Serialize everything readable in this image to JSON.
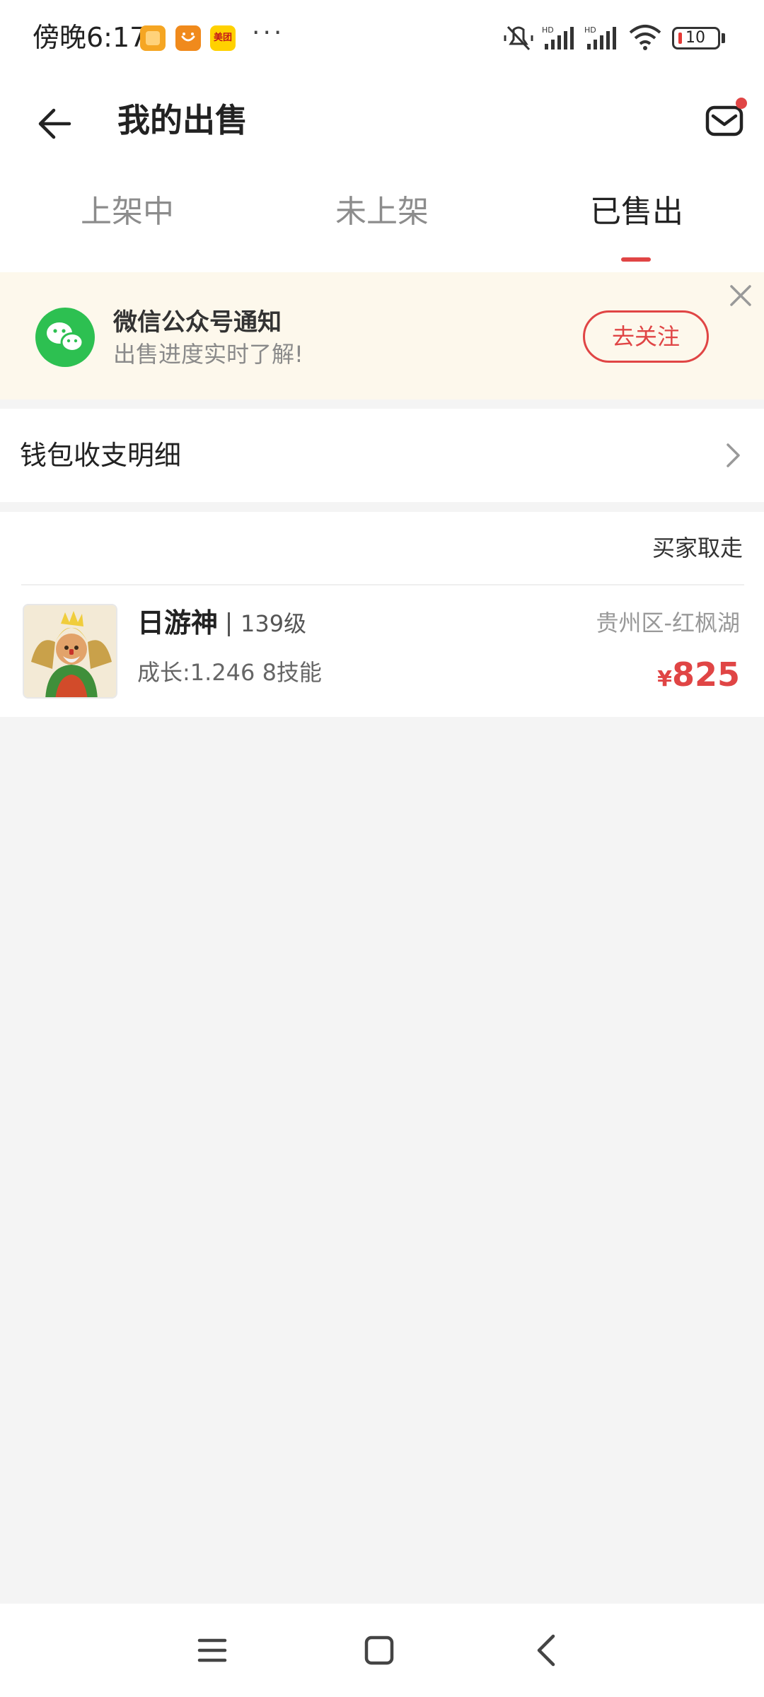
{
  "status_bar": {
    "time": "傍晚6:17",
    "app_icons": [
      "gallery-icon",
      "taobao-icon",
      "meituan-icon"
    ],
    "meituan_text": "美团",
    "more": "···",
    "battery": "10"
  },
  "header": {
    "title": "我的出售",
    "back_icon": "back-arrow-icon",
    "message_icon": "mail-icon",
    "has_unread_dot": true
  },
  "tabs": [
    {
      "label": "上架中",
      "active": false
    },
    {
      "label": "未上架",
      "active": false
    },
    {
      "label": "已售出",
      "active": true
    }
  ],
  "notice": {
    "title": "微信公众号通知",
    "subtitle": "出售进度实时了解!",
    "button": "去关注",
    "icon": "wechat-icon"
  },
  "wallet": {
    "label": "钱包收支明细"
  },
  "orders": [
    {
      "status": "买家取走",
      "name": "日游神",
      "level": "139级",
      "stats": "成长:1.246 8技能",
      "server": "贵州区-红枫湖",
      "currency": "¥",
      "price": "825"
    }
  ],
  "colors": {
    "accent": "#e04545",
    "wechat_green": "#2dc051",
    "notice_bg": "#fdf8ec",
    "page_bg": "#f4f4f4"
  }
}
